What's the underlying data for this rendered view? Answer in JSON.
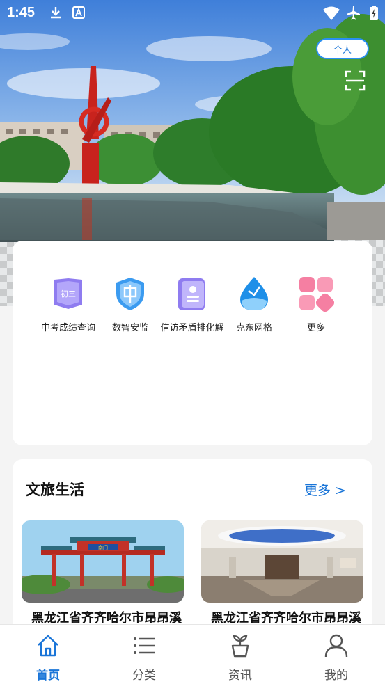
{
  "status_bar": {
    "time": "1:45"
  },
  "header": {
    "personal_button": "个人"
  },
  "services": [
    {
      "label": "中考成绩查询",
      "icon": "book-badge-icon",
      "badge": "初三"
    },
    {
      "label": "数智安监",
      "icon": "shield-icon"
    },
    {
      "label": "信访矛盾排化解",
      "icon": "document-icon"
    },
    {
      "label": "克东网格",
      "icon": "water-drop-icon"
    },
    {
      "label": "更多",
      "icon": "grid-icon"
    }
  ],
  "culture": {
    "title": "文旅生活",
    "more": "更多 >",
    "items": [
      {
        "caption": "黑龙江省齐齐哈尔市昂昂溪",
        "sign": "南门"
      },
      {
        "caption": "黑龙江省齐齐哈尔市昂昂溪"
      }
    ]
  },
  "nav": [
    {
      "label": "首页",
      "icon": "home-icon",
      "active": true
    },
    {
      "label": "分类",
      "icon": "list-icon",
      "active": false
    },
    {
      "label": "资讯",
      "icon": "plant-pot-icon",
      "active": false
    },
    {
      "label": "我的",
      "icon": "person-icon",
      "active": false
    }
  ],
  "colors": {
    "accent": "#1a75d8",
    "background": "#f4f4f4"
  }
}
